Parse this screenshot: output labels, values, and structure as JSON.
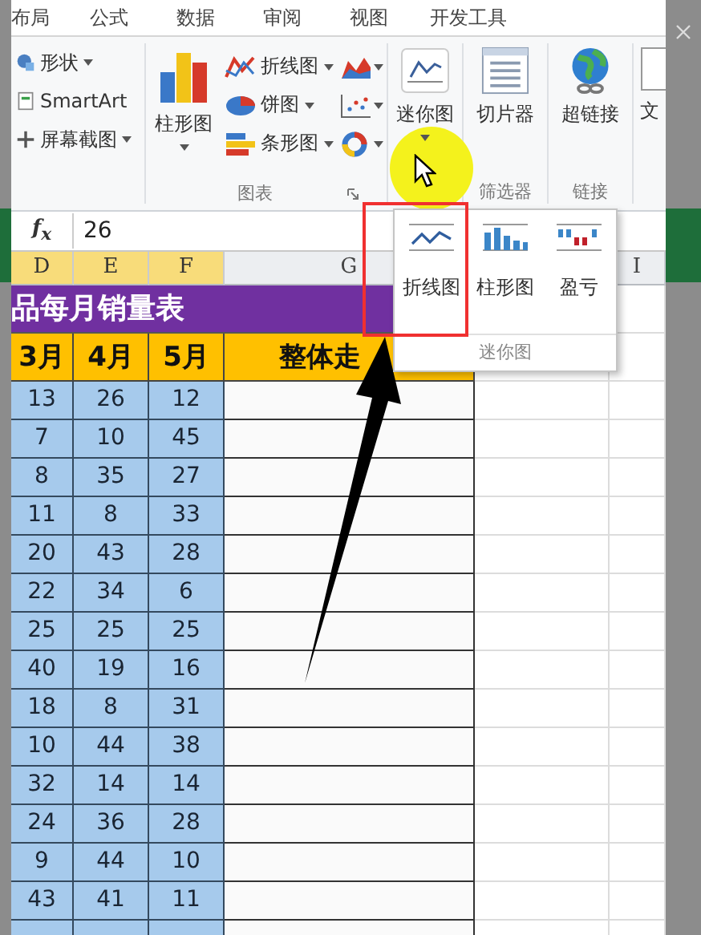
{
  "ribbon_tabs": [
    "布局",
    "公式",
    "数据",
    "审阅",
    "视图",
    "开发工具"
  ],
  "ribbon": {
    "illustrations": [
      {
        "label": "形状",
        "kind": "shapes",
        "dropdown": true
      },
      {
        "label": "SmartArt",
        "kind": "smartart",
        "dropdown": false
      },
      {
        "label": "屏幕截图",
        "kind": "screenshot",
        "dropdown": true
      }
    ],
    "charts": {
      "big": {
        "label": "柱形图"
      },
      "small": [
        {
          "label": "折线图",
          "kind": "line"
        },
        {
          "label": "饼图",
          "kind": "pie"
        },
        {
          "label": "条形图",
          "kind": "bar"
        }
      ],
      "group_label": "图表"
    },
    "sparkline_button": {
      "label": "迷你图"
    },
    "slicer": {
      "label": "切片器",
      "group_label": "筛选器"
    },
    "hyperlink": {
      "label": "超链接",
      "group_label": "链接"
    },
    "text_button": {
      "label": "文"
    }
  },
  "formula_bar": {
    "fx": "f$_{x}$",
    "value": "26"
  },
  "columns": [
    "D",
    "E",
    "F",
    "G",
    "I"
  ],
  "sheet": {
    "title": "品每月销量表",
    "headers": [
      "3月",
      "4月",
      "5月",
      "整体走"
    ],
    "rows": [
      [
        "13",
        "26",
        "12"
      ],
      [
        "7",
        "10",
        "45"
      ],
      [
        "8",
        "35",
        "27"
      ],
      [
        "11",
        "8",
        "33"
      ],
      [
        "20",
        "43",
        "28"
      ],
      [
        "22",
        "34",
        "6"
      ],
      [
        "25",
        "25",
        "25"
      ],
      [
        "40",
        "19",
        "16"
      ],
      [
        "18",
        "8",
        "31"
      ],
      [
        "10",
        "44",
        "38"
      ],
      [
        "32",
        "14",
        "14"
      ],
      [
        "24",
        "36",
        "28"
      ],
      [
        "9",
        "44",
        "10"
      ],
      [
        "43",
        "41",
        "11"
      ]
    ]
  },
  "sparkline_menu": {
    "items": [
      {
        "label": "折线图",
        "kind": "line",
        "selected": true
      },
      {
        "label": "柱形图",
        "kind": "column",
        "selected": false
      },
      {
        "label": "盈亏",
        "kind": "winloss",
        "selected": false
      }
    ],
    "group_label": "迷你图"
  }
}
